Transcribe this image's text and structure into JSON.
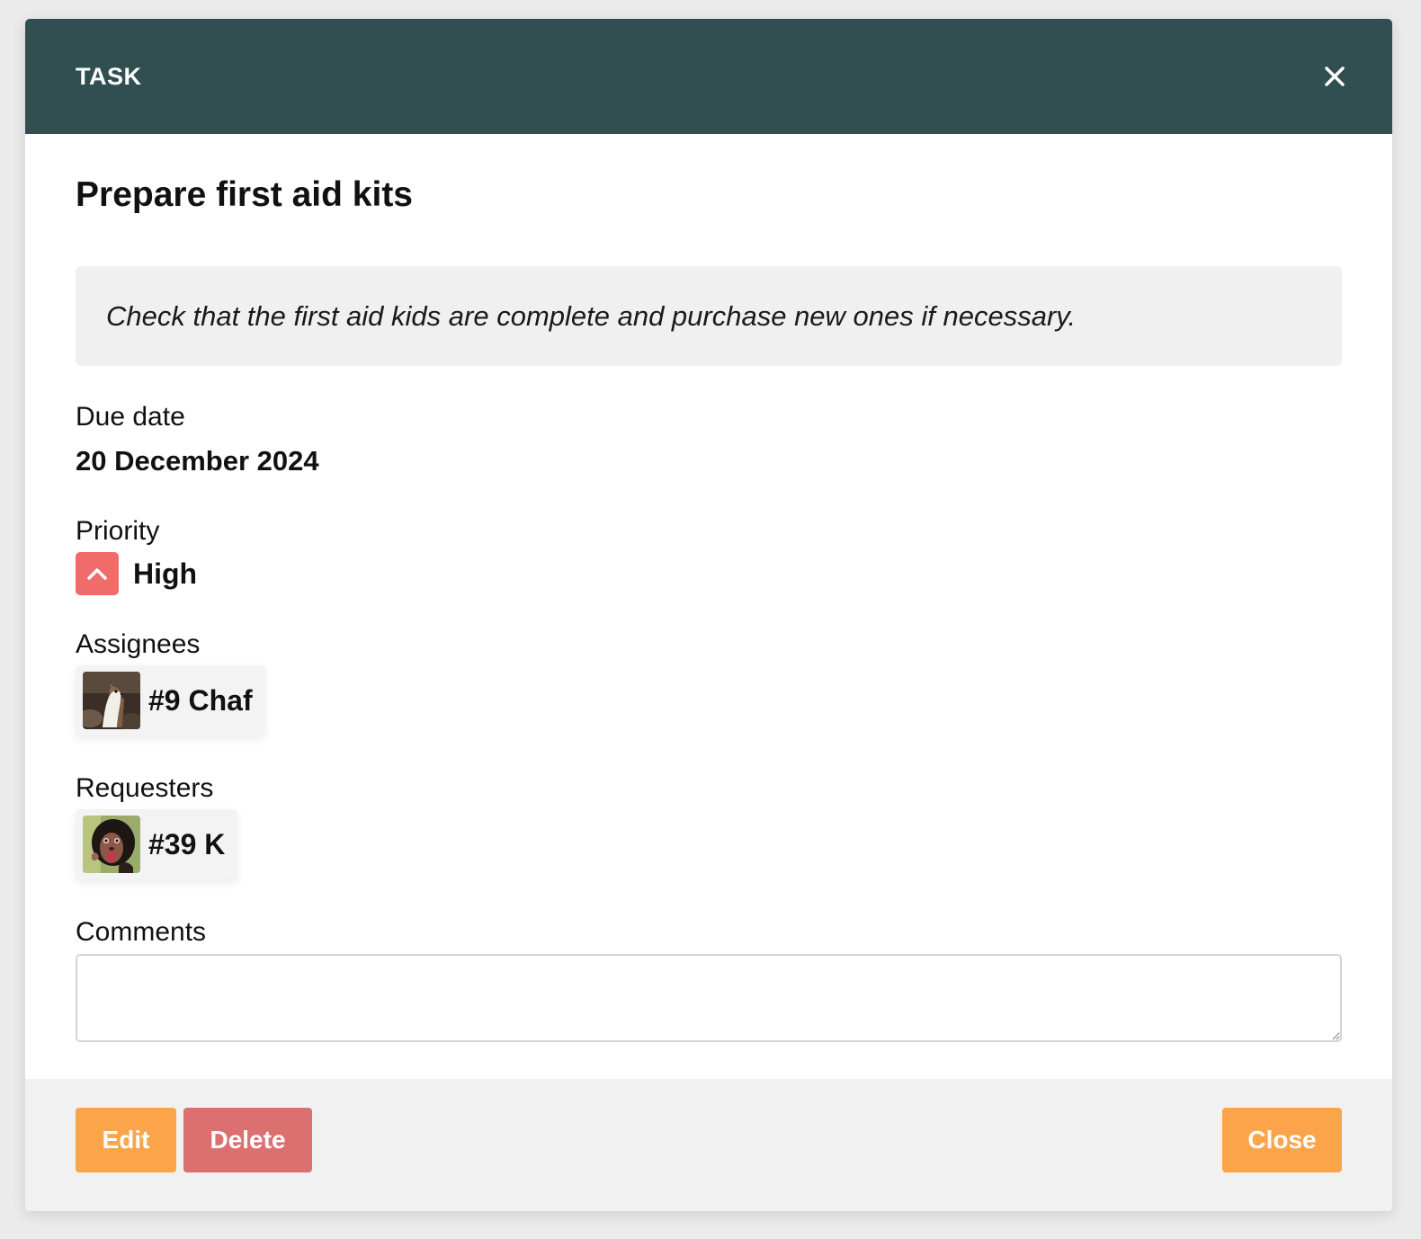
{
  "header": {
    "title": "TASK",
    "close_icon": "close-icon"
  },
  "task": {
    "title": "Prepare first aid kits",
    "description": "Check that the first aid kids are complete and purchase new ones if necessary."
  },
  "due_date": {
    "label": "Due date",
    "value": "20 December 2024"
  },
  "priority": {
    "label": "Priority",
    "value": "High",
    "icon": "chevron-up-icon",
    "color": "#f26b6b"
  },
  "assignees": {
    "label": "Assignees",
    "people": [
      {
        "name": "#9 Chaf",
        "avatar": "stoat-avatar"
      }
    ]
  },
  "requesters": {
    "label": "Requesters",
    "people": [
      {
        "name": "#39 K",
        "avatar": "monkey-avatar"
      }
    ]
  },
  "comments": {
    "label": "Comments",
    "value": ""
  },
  "footer": {
    "edit_label": "Edit",
    "delete_label": "Delete",
    "close_label": "Close"
  },
  "colors": {
    "header_bg": "#314f50",
    "primary": "#fba449",
    "danger": "#dc6f6f"
  }
}
